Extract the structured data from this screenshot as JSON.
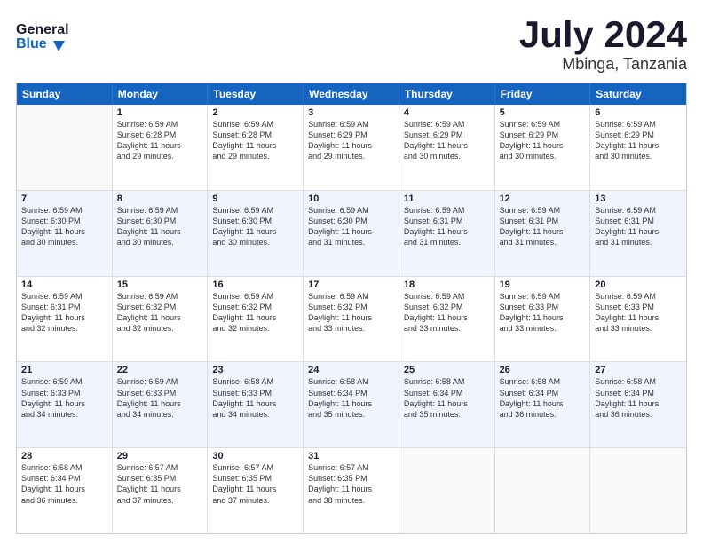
{
  "header": {
    "logo_line1": "General",
    "logo_line2": "Blue",
    "month": "July 2024",
    "location": "Mbinga, Tanzania"
  },
  "days": [
    "Sunday",
    "Monday",
    "Tuesday",
    "Wednesday",
    "Thursday",
    "Friday",
    "Saturday"
  ],
  "weeks": [
    [
      {
        "day": "",
        "lines": []
      },
      {
        "day": "1",
        "lines": [
          "Sunrise: 6:59 AM",
          "Sunset: 6:28 PM",
          "Daylight: 11 hours",
          "and 29 minutes."
        ]
      },
      {
        "day": "2",
        "lines": [
          "Sunrise: 6:59 AM",
          "Sunset: 6:28 PM",
          "Daylight: 11 hours",
          "and 29 minutes."
        ]
      },
      {
        "day": "3",
        "lines": [
          "Sunrise: 6:59 AM",
          "Sunset: 6:29 PM",
          "Daylight: 11 hours",
          "and 29 minutes."
        ]
      },
      {
        "day": "4",
        "lines": [
          "Sunrise: 6:59 AM",
          "Sunset: 6:29 PM",
          "Daylight: 11 hours",
          "and 30 minutes."
        ]
      },
      {
        "day": "5",
        "lines": [
          "Sunrise: 6:59 AM",
          "Sunset: 6:29 PM",
          "Daylight: 11 hours",
          "and 30 minutes."
        ]
      },
      {
        "day": "6",
        "lines": [
          "Sunrise: 6:59 AM",
          "Sunset: 6:29 PM",
          "Daylight: 11 hours",
          "and 30 minutes."
        ]
      }
    ],
    [
      {
        "day": "7",
        "lines": [
          "Sunrise: 6:59 AM",
          "Sunset: 6:30 PM",
          "Daylight: 11 hours",
          "and 30 minutes."
        ]
      },
      {
        "day": "8",
        "lines": [
          "Sunrise: 6:59 AM",
          "Sunset: 6:30 PM",
          "Daylight: 11 hours",
          "and 30 minutes."
        ]
      },
      {
        "day": "9",
        "lines": [
          "Sunrise: 6:59 AM",
          "Sunset: 6:30 PM",
          "Daylight: 11 hours",
          "and 30 minutes."
        ]
      },
      {
        "day": "10",
        "lines": [
          "Sunrise: 6:59 AM",
          "Sunset: 6:30 PM",
          "Daylight: 11 hours",
          "and 31 minutes."
        ]
      },
      {
        "day": "11",
        "lines": [
          "Sunrise: 6:59 AM",
          "Sunset: 6:31 PM",
          "Daylight: 11 hours",
          "and 31 minutes."
        ]
      },
      {
        "day": "12",
        "lines": [
          "Sunrise: 6:59 AM",
          "Sunset: 6:31 PM",
          "Daylight: 11 hours",
          "and 31 minutes."
        ]
      },
      {
        "day": "13",
        "lines": [
          "Sunrise: 6:59 AM",
          "Sunset: 6:31 PM",
          "Daylight: 11 hours",
          "and 31 minutes."
        ]
      }
    ],
    [
      {
        "day": "14",
        "lines": [
          "Sunrise: 6:59 AM",
          "Sunset: 6:31 PM",
          "Daylight: 11 hours",
          "and 32 minutes."
        ]
      },
      {
        "day": "15",
        "lines": [
          "Sunrise: 6:59 AM",
          "Sunset: 6:32 PM",
          "Daylight: 11 hours",
          "and 32 minutes."
        ]
      },
      {
        "day": "16",
        "lines": [
          "Sunrise: 6:59 AM",
          "Sunset: 6:32 PM",
          "Daylight: 11 hours",
          "and 32 minutes."
        ]
      },
      {
        "day": "17",
        "lines": [
          "Sunrise: 6:59 AM",
          "Sunset: 6:32 PM",
          "Daylight: 11 hours",
          "and 33 minutes."
        ]
      },
      {
        "day": "18",
        "lines": [
          "Sunrise: 6:59 AM",
          "Sunset: 6:32 PM",
          "Daylight: 11 hours",
          "and 33 minutes."
        ]
      },
      {
        "day": "19",
        "lines": [
          "Sunrise: 6:59 AM",
          "Sunset: 6:33 PM",
          "Daylight: 11 hours",
          "and 33 minutes."
        ]
      },
      {
        "day": "20",
        "lines": [
          "Sunrise: 6:59 AM",
          "Sunset: 6:33 PM",
          "Daylight: 11 hours",
          "and 33 minutes."
        ]
      }
    ],
    [
      {
        "day": "21",
        "lines": [
          "Sunrise: 6:59 AM",
          "Sunset: 6:33 PM",
          "Daylight: 11 hours",
          "and 34 minutes."
        ]
      },
      {
        "day": "22",
        "lines": [
          "Sunrise: 6:59 AM",
          "Sunset: 6:33 PM",
          "Daylight: 11 hours",
          "and 34 minutes."
        ]
      },
      {
        "day": "23",
        "lines": [
          "Sunrise: 6:58 AM",
          "Sunset: 6:33 PM",
          "Daylight: 11 hours",
          "and 34 minutes."
        ]
      },
      {
        "day": "24",
        "lines": [
          "Sunrise: 6:58 AM",
          "Sunset: 6:34 PM",
          "Daylight: 11 hours",
          "and 35 minutes."
        ]
      },
      {
        "day": "25",
        "lines": [
          "Sunrise: 6:58 AM",
          "Sunset: 6:34 PM",
          "Daylight: 11 hours",
          "and 35 minutes."
        ]
      },
      {
        "day": "26",
        "lines": [
          "Sunrise: 6:58 AM",
          "Sunset: 6:34 PM",
          "Daylight: 11 hours",
          "and 36 minutes."
        ]
      },
      {
        "day": "27",
        "lines": [
          "Sunrise: 6:58 AM",
          "Sunset: 6:34 PM",
          "Daylight: 11 hours",
          "and 36 minutes."
        ]
      }
    ],
    [
      {
        "day": "28",
        "lines": [
          "Sunrise: 6:58 AM",
          "Sunset: 6:34 PM",
          "Daylight: 11 hours",
          "and 36 minutes."
        ]
      },
      {
        "day": "29",
        "lines": [
          "Sunrise: 6:57 AM",
          "Sunset: 6:35 PM",
          "Daylight: 11 hours",
          "and 37 minutes."
        ]
      },
      {
        "day": "30",
        "lines": [
          "Sunrise: 6:57 AM",
          "Sunset: 6:35 PM",
          "Daylight: 11 hours",
          "and 37 minutes."
        ]
      },
      {
        "day": "31",
        "lines": [
          "Sunrise: 6:57 AM",
          "Sunset: 6:35 PM",
          "Daylight: 11 hours",
          "and 38 minutes."
        ]
      },
      {
        "day": "",
        "lines": []
      },
      {
        "day": "",
        "lines": []
      },
      {
        "day": "",
        "lines": []
      }
    ]
  ]
}
